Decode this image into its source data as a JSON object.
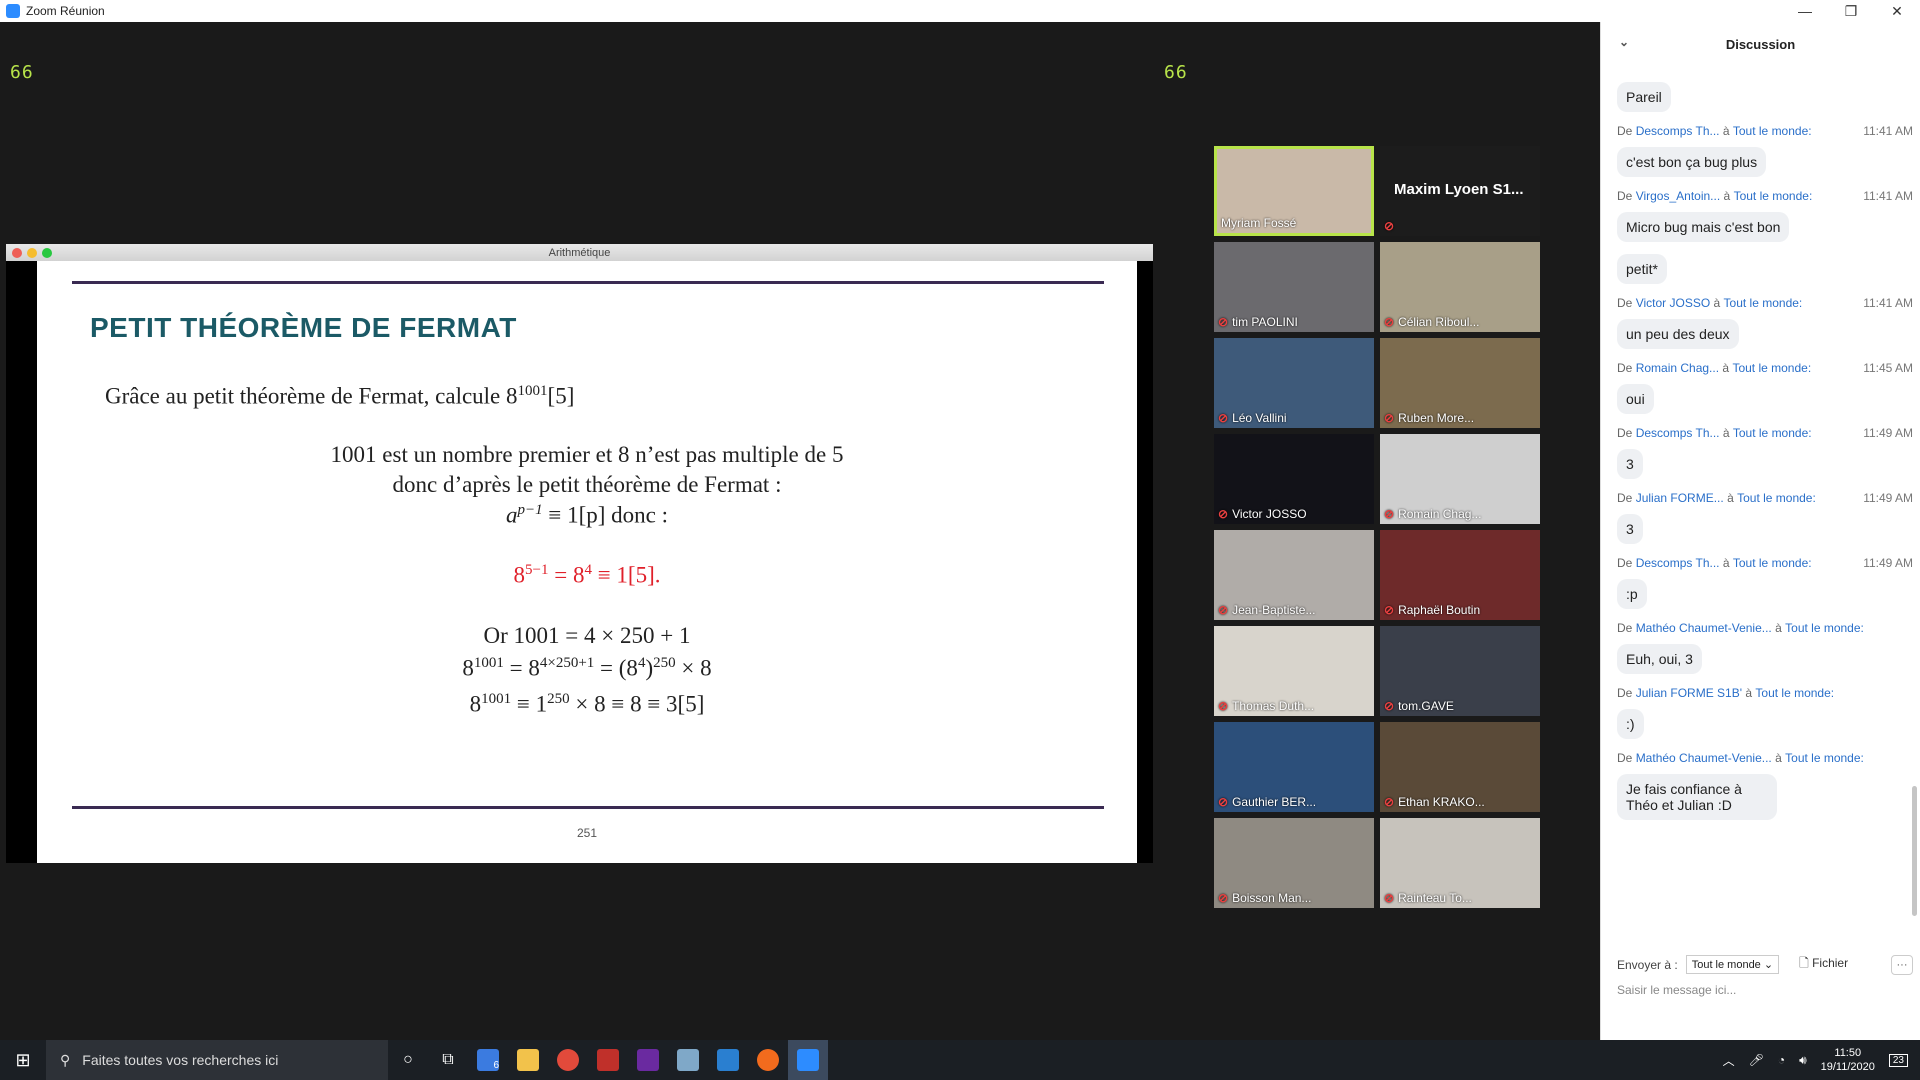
{
  "window": {
    "title": "Zoom Réunion",
    "controls": [
      "—",
      "❐",
      "✕"
    ]
  },
  "counters": {
    "left": "66",
    "right": "66"
  },
  "share": {
    "window_title": "Arithmétique",
    "slide": {
      "heading": "PETIT THÉORÈME DE FERMAT",
      "question": "Grâce au petit théorème de Fermat, calcule 8",
      "question_exp": "1001",
      "question_mod": "[5]",
      "l1": "1001 est un nombre premier et 8 n’est pas multiple de 5",
      "l2": "donc d’après le petit théorème de Fermat :",
      "l3a": "a",
      "l3b": "p−1",
      "l3c": " ≡ 1[p] donc :",
      "red_a": "8",
      "red_b": "5−1",
      "red_c": " = 8",
      "red_d": "4",
      "red_e": " ≡ 1[5].",
      "l4": "Or 1001 = 4 × 250 + 1",
      "l5a": "8",
      "l5b": "1001",
      "l5c": " = 8",
      "l5d": "4×250+1",
      "l5e": " = (8",
      "l5f": "4",
      "l5g": ")",
      "l5h": "250",
      "l5i": " × 8",
      "l6a": "8",
      "l6b": "1001",
      "l6c": " ≡ 1",
      "l6d": "250",
      "l6e": " × 8 ≡ 8 ≡ 3[5]",
      "page": "251"
    }
  },
  "participants": [
    {
      "name": "Myriam Fossé",
      "muted": false,
      "active": true,
      "bg": "#c9b9a8"
    },
    {
      "name": "Maxim  Lyoen  S1...",
      "muted": true,
      "noimg": true,
      "bg": "#1c1c1c"
    },
    {
      "name": "tim PAOLINI",
      "muted": true,
      "bg": "#6b6a6e"
    },
    {
      "name": "Célian Riboul...",
      "muted": true,
      "bg": "#a89f88"
    },
    {
      "name": "Léo Vallini",
      "muted": true,
      "bg": "#3e5a7a"
    },
    {
      "name": "Ruben More...",
      "muted": true,
      "bg": "#7c6b4e"
    },
    {
      "name": "Victor JOSSO",
      "muted": true,
      "bg": "#121218"
    },
    {
      "name": "Romain Chag...",
      "muted": true,
      "bg": "#cfcfcf"
    },
    {
      "name": "Jean-Baptiste...",
      "muted": true,
      "bg": "#b0aca8"
    },
    {
      "name": "Raphaël Boutin",
      "muted": true,
      "bg": "#6e2a2a"
    },
    {
      "name": "Thomas Duth...",
      "muted": true,
      "bg": "#d8d4cc"
    },
    {
      "name": "tom.GAVE",
      "muted": true,
      "bg": "#3a3f4a"
    },
    {
      "name": "Gauthier BER...",
      "muted": true,
      "bg": "#2c4f7a"
    },
    {
      "name": "Ethan KRAKO...",
      "muted": true,
      "bg": "#5a4a38"
    },
    {
      "name": "Boisson Man...",
      "muted": true,
      "bg": "#8f8a82"
    },
    {
      "name": "Rainteau To...",
      "muted": true,
      "bg": "#c7c3bc"
    }
  ],
  "chat": {
    "title": "Discussion",
    "messages": [
      {
        "type": "bubble",
        "text": "Pareil"
      },
      {
        "type": "meta",
        "who": "Descomps Th...",
        "to": "Tout le monde:",
        "time": "11:41 AM"
      },
      {
        "type": "bubble",
        "text": "c'est bon ça bug plus"
      },
      {
        "type": "meta",
        "who": "Virgos_Antoin...",
        "to": "Tout le monde:",
        "time": "11:41 AM"
      },
      {
        "type": "bubble",
        "text": "Micro bug mais c'est bon"
      },
      {
        "type": "bubble",
        "text": "petit*"
      },
      {
        "type": "meta",
        "who": "Victor JOSSO",
        "to": "Tout le monde:",
        "time": "11:41 AM"
      },
      {
        "type": "bubble",
        "text": "un peu des deux"
      },
      {
        "type": "meta",
        "who": "Romain Chag...",
        "to": "Tout le monde:",
        "time": "11:45 AM"
      },
      {
        "type": "bubble",
        "text": "oui"
      },
      {
        "type": "meta",
        "who": "Descomps Th...",
        "to": "Tout le monde:",
        "time": "11:49 AM"
      },
      {
        "type": "bubble",
        "text": "3"
      },
      {
        "type": "meta",
        "who": "Julian FORME...",
        "to": "Tout le monde:",
        "time": "11:49 AM"
      },
      {
        "type": "bubble",
        "text": "3"
      },
      {
        "type": "meta",
        "who": "Descomps Th...",
        "to": "Tout le monde:",
        "time": "11:49 AM"
      },
      {
        "type": "bubble",
        "text": ":p"
      },
      {
        "type": "meta",
        "who": "Mathéo Chaumet-Venie...",
        "to": "Tout le monde:",
        "time": ""
      },
      {
        "type": "bubble",
        "text": "Euh, oui, 3"
      },
      {
        "type": "meta",
        "who": "Julian FORME S1B'",
        "to": "Tout le monde:",
        "time": ""
      },
      {
        "type": "bubble",
        "text": ":)"
      },
      {
        "type": "meta",
        "who": "Mathéo Chaumet-Venie...",
        "to": "Tout le monde:",
        "time": ""
      },
      {
        "type": "bubble",
        "text": "Je fais confiance à Théo et Julian :D"
      }
    ],
    "from_label": "De",
    "to_label": "à",
    "send_to_label": "Envoyer à :",
    "send_to_value": "Tout le monde",
    "file_label": "Fichier",
    "more_label": "···",
    "input_placeholder": "Saisir le message ici..."
  },
  "taskbar": {
    "search_placeholder": "Faites toutes vos recherches ici",
    "time": "11:50",
    "date": "19/11/2020",
    "badge": "6",
    "notif": "23"
  }
}
